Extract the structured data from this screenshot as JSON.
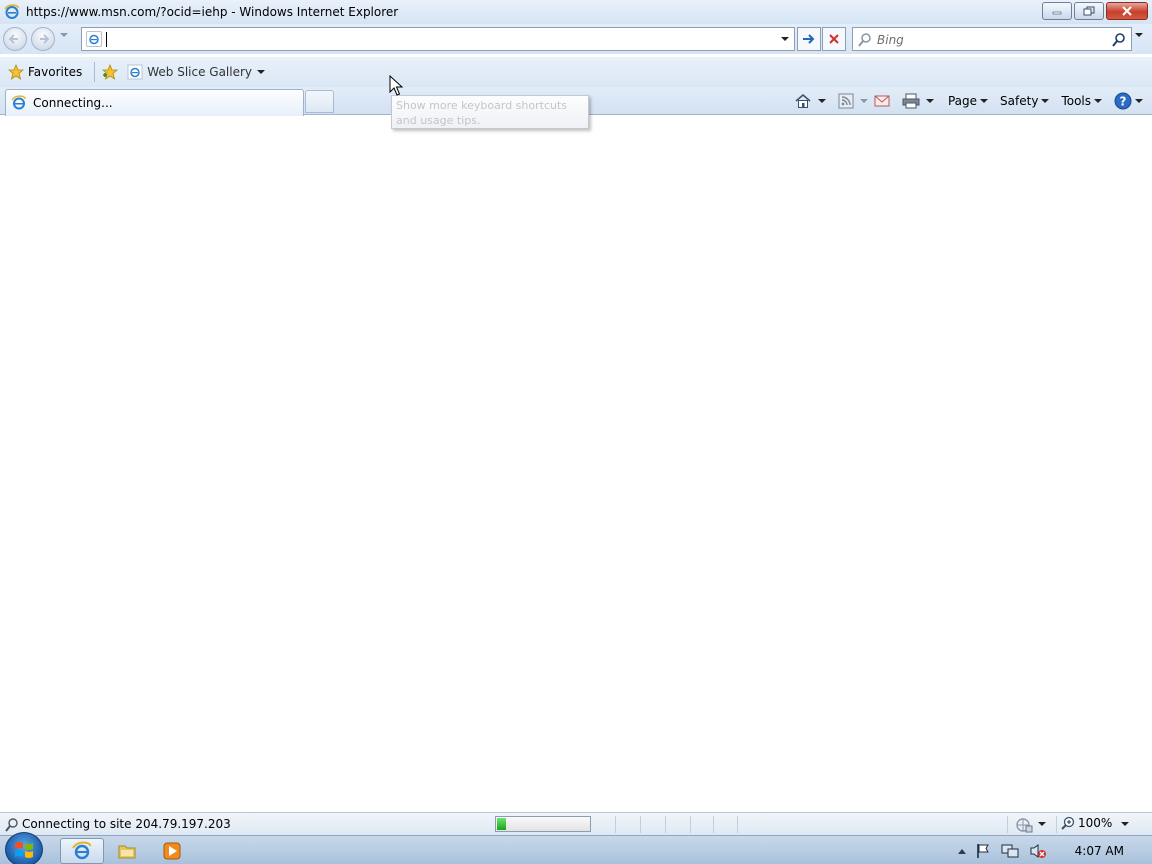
{
  "window": {
    "title": "https://www.msn.com/?ocid=iehp - Windows Internet Explorer",
    "icon": "ie-logo-icon",
    "controls": [
      "minimize-icon",
      "restore-icon",
      "close-icon"
    ]
  },
  "navigation": {
    "address_value": "",
    "search_placeholder": "Bing"
  },
  "favorites_bar": {
    "favorites_label": "Favorites",
    "web_slice_label": "Web Slice Gallery"
  },
  "tabs": [
    {
      "label": "Connecting...",
      "active": true
    }
  ],
  "command_bar": {
    "page_label": "Page",
    "safety_label": "Safety",
    "tools_label": "Tools"
  },
  "tooltip": {
    "text": "Show more keyboard shortcuts and usage tips."
  },
  "status_bar": {
    "text": "Connecting to site 204.79.197.203",
    "progress": 0.1,
    "zoom": "100%"
  },
  "taskbar": {
    "clock": "4:07 AM",
    "pinned": [
      "internet-explorer-icon",
      "windows-explorer-icon",
      "media-player-icon"
    ]
  },
  "colors": {
    "chrome_blue": "#d6e5f5",
    "progress_green": "#19a319",
    "close_red": "#c7402d"
  }
}
